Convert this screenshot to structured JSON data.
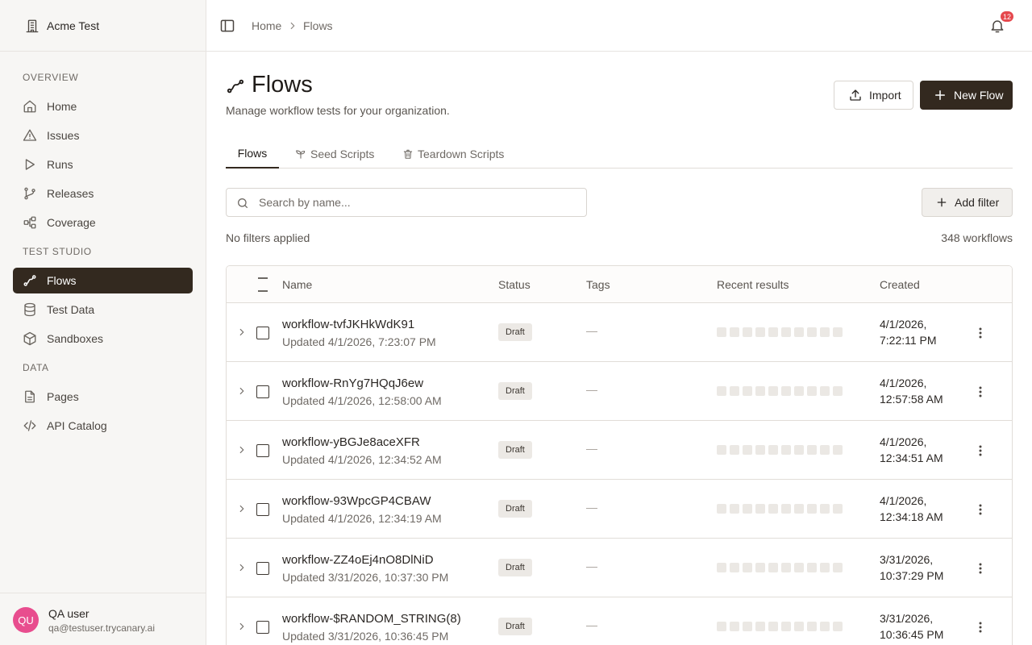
{
  "org": {
    "name": "Acme Test"
  },
  "nav": {
    "overview_label": "OVERVIEW",
    "test_studio_label": "TEST STUDIO",
    "data_label": "DATA",
    "home": "Home",
    "issues": "Issues",
    "runs": "Runs",
    "releases": "Releases",
    "coverage": "Coverage",
    "flows": "Flows",
    "test_data": "Test Data",
    "sandboxes": "Sandboxes",
    "pages": "Pages",
    "api_catalog": "API Catalog"
  },
  "user": {
    "initials": "QU",
    "name": "QA user",
    "email": "qa@testuser.trycanary.ai"
  },
  "breadcrumb": {
    "home": "Home",
    "current": "Flows"
  },
  "notifications": {
    "count": "12"
  },
  "page": {
    "title": "Flows",
    "subtitle": "Manage workflow tests for your organization.",
    "import_label": "Import",
    "new_flow_label": "New Flow"
  },
  "tabs": {
    "flows": "Flows",
    "seed": "Seed Scripts",
    "teardown": "Teardown Scripts"
  },
  "search": {
    "placeholder": "Search by name..."
  },
  "filter": {
    "add_label": "Add filter",
    "status": "No filters applied",
    "count": "348 workflows"
  },
  "table": {
    "headers": {
      "name": "Name",
      "status": "Status",
      "tags": "Tags",
      "recent": "Recent results",
      "created": "Created"
    },
    "rows": [
      {
        "name": "workflow-tvfJKHkWdK91",
        "updated": "Updated 4/1/2026, 7:23:07 PM",
        "status": "Draft",
        "tags": "—",
        "created": "4/1/2026, 7:22:11 PM"
      },
      {
        "name": "workflow-RnYg7HQqJ6ew",
        "updated": "Updated 4/1/2026, 12:58:00 AM",
        "status": "Draft",
        "tags": "—",
        "created": "4/1/2026, 12:57:58 AM"
      },
      {
        "name": "workflow-yBGJe8aceXFR",
        "updated": "Updated 4/1/2026, 12:34:52 AM",
        "status": "Draft",
        "tags": "—",
        "created": "4/1/2026, 12:34:51 AM"
      },
      {
        "name": "workflow-93WpcGP4CBAW",
        "updated": "Updated 4/1/2026, 12:34:19 AM",
        "status": "Draft",
        "tags": "—",
        "created": "4/1/2026, 12:34:18 AM"
      },
      {
        "name": "workflow-ZZ4oEj4nO8DlNiD",
        "updated": "Updated 3/31/2026, 10:37:30 PM",
        "status": "Draft",
        "tags": "—",
        "created": "3/31/2026, 10:37:29 PM"
      },
      {
        "name": "workflow-$RANDOM_STRING(8)",
        "updated": "Updated 3/31/2026, 10:36:45 PM",
        "status": "Draft",
        "tags": "—",
        "created": "3/31/2026, 10:36:45 PM"
      }
    ]
  },
  "colors": {
    "accent": "#33291f",
    "badge": "#e5484d",
    "avatar": "#e84d8e"
  }
}
